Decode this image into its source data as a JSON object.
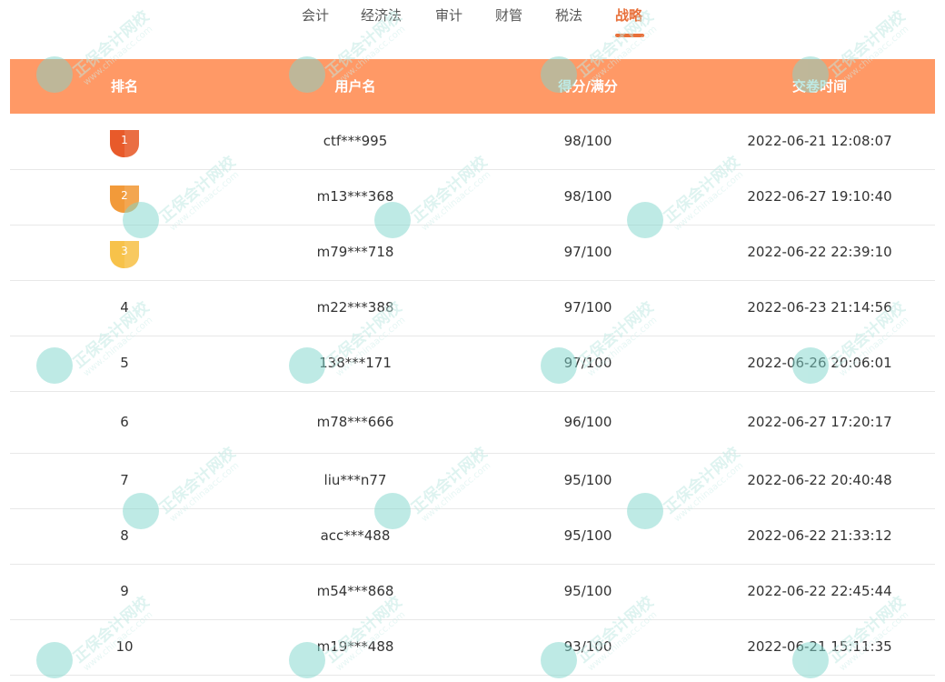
{
  "tabs": [
    {
      "label": "会计",
      "active": false
    },
    {
      "label": "经济法",
      "active": false
    },
    {
      "label": "审计",
      "active": false
    },
    {
      "label": "财管",
      "active": false
    },
    {
      "label": "税法",
      "active": false
    },
    {
      "label": "战略",
      "active": true
    }
  ],
  "colors": {
    "accent": "#e8703a",
    "header_bg": "#ff9966",
    "medal_gold": "#e85a2a",
    "medal_silver": "#f29a3a",
    "medal_bronze": "#f7c24a"
  },
  "table": {
    "headers": [
      "排名",
      "用户名",
      "得分/满分",
      "交卷时间"
    ],
    "rows": [
      {
        "rank": "1",
        "medal": true,
        "user": "ctf***995",
        "score": "98/100",
        "time": "2022-06-21 12:08:07"
      },
      {
        "rank": "2",
        "medal": true,
        "user": "m13***368",
        "score": "98/100",
        "time": "2022-06-27 19:10:40"
      },
      {
        "rank": "3",
        "medal": true,
        "user": "m79***718",
        "score": "97/100",
        "time": "2022-06-22 22:39:10"
      },
      {
        "rank": "4",
        "medal": false,
        "user": "m22***388",
        "score": "97/100",
        "time": "2022-06-23 21:14:56"
      },
      {
        "rank": "5",
        "medal": false,
        "user": "138***171",
        "score": "97/100",
        "time": "2022-06-26 20:06:01"
      },
      {
        "rank": "6",
        "medal": false,
        "user": "m78***666",
        "score": "96/100",
        "time": "2022-06-27 17:20:17"
      },
      {
        "rank": "7",
        "medal": false,
        "user": "liu***n77",
        "score": "95/100",
        "time": "2022-06-22 20:40:48"
      },
      {
        "rank": "8",
        "medal": false,
        "user": "acc***488",
        "score": "95/100",
        "time": "2022-06-22 21:33:12"
      },
      {
        "rank": "9",
        "medal": false,
        "user": "m54***868",
        "score": "95/100",
        "time": "2022-06-22 22:45:44"
      },
      {
        "rank": "10",
        "medal": false,
        "user": "m19***488",
        "score": "93/100",
        "time": "2022-06-21 15:11:35"
      }
    ]
  },
  "watermark": {
    "text": "正保会计网校",
    "url": "www.chinaacc.com",
    "icon": "chinaacc-logo-icon"
  }
}
